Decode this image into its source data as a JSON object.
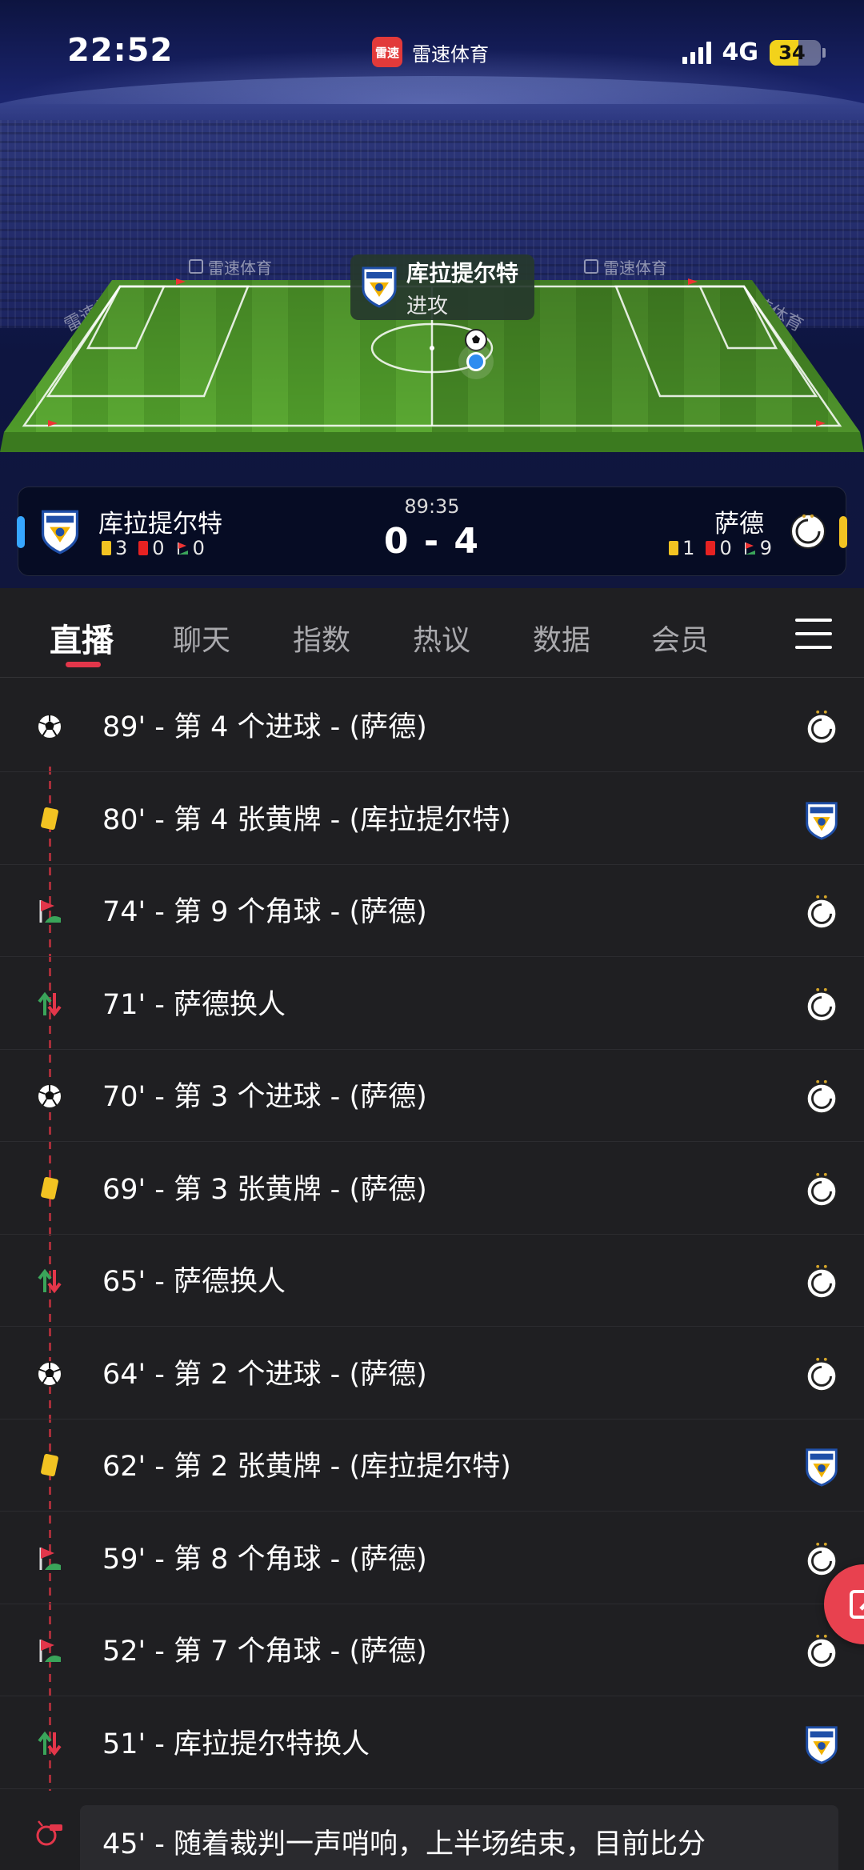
{
  "status_bar": {
    "time": "22:52",
    "app_logo_text": "雷速",
    "app_name": "雷速体育",
    "network": "4G",
    "battery": "34"
  },
  "pitch": {
    "ad_text": "雷速体育",
    "attack_team": "库拉提尔特",
    "attack_action": "进攻"
  },
  "scoreboard": {
    "home": {
      "name": "库拉提尔特",
      "yellow": "3",
      "red": "0",
      "corners": "0",
      "color": "#36a6ff"
    },
    "away": {
      "name": "萨德",
      "yellow": "1",
      "red": "0",
      "corners": "9",
      "color": "#f2c322"
    },
    "clock": "89:35",
    "score": "0 - 4"
  },
  "tabs": [
    {
      "label": "直播",
      "active": true
    },
    {
      "label": "聊天",
      "active": false
    },
    {
      "label": "指数",
      "active": false
    },
    {
      "label": "热议",
      "active": false
    },
    {
      "label": "数据",
      "active": false
    },
    {
      "label": "会员",
      "active": false
    }
  ],
  "events": [
    {
      "text": "89' - 第 4 个进球 - (萨德)",
      "type": "goal-icon",
      "team": "away"
    },
    {
      "text": "80' - 第 4 张黄牌 - (库拉提尔特)",
      "type": "yellow-card-icon",
      "team": "home"
    },
    {
      "text": "74' - 第 9 个角球 - (萨德)",
      "type": "corner-icon",
      "team": "away"
    },
    {
      "text": "71' - 萨德换人",
      "type": "substitution-icon",
      "team": "away"
    },
    {
      "text": "70' - 第 3 个进球 - (萨德)",
      "type": "goal-icon",
      "team": "away"
    },
    {
      "text": "69' - 第 3 张黄牌 - (萨德)",
      "type": "yellow-card-icon",
      "team": "away"
    },
    {
      "text": "65' - 萨德换人",
      "type": "substitution-icon",
      "team": "away"
    },
    {
      "text": "64' - 第 2 个进球 - (萨德)",
      "type": "goal-icon",
      "team": "away"
    },
    {
      "text": "62' - 第 2 张黄牌 - (库拉提尔特)",
      "type": "yellow-card-icon",
      "team": "home"
    },
    {
      "text": "59' - 第 8 个角球 - (萨德)",
      "type": "corner-icon",
      "team": "away"
    },
    {
      "text": "52' - 第 7 个角球 - (萨德)",
      "type": "corner-icon",
      "team": "away"
    },
    {
      "text": "51' - 库拉提尔特换人",
      "type": "substitution-icon",
      "team": "home"
    }
  ],
  "last_event": {
    "text": "45' - 随着裁判一声哨响，上半场结束，目前比分",
    "type": "whistle-icon"
  },
  "colors": {
    "accent": "#e3364a",
    "background": "#1f1f22"
  }
}
